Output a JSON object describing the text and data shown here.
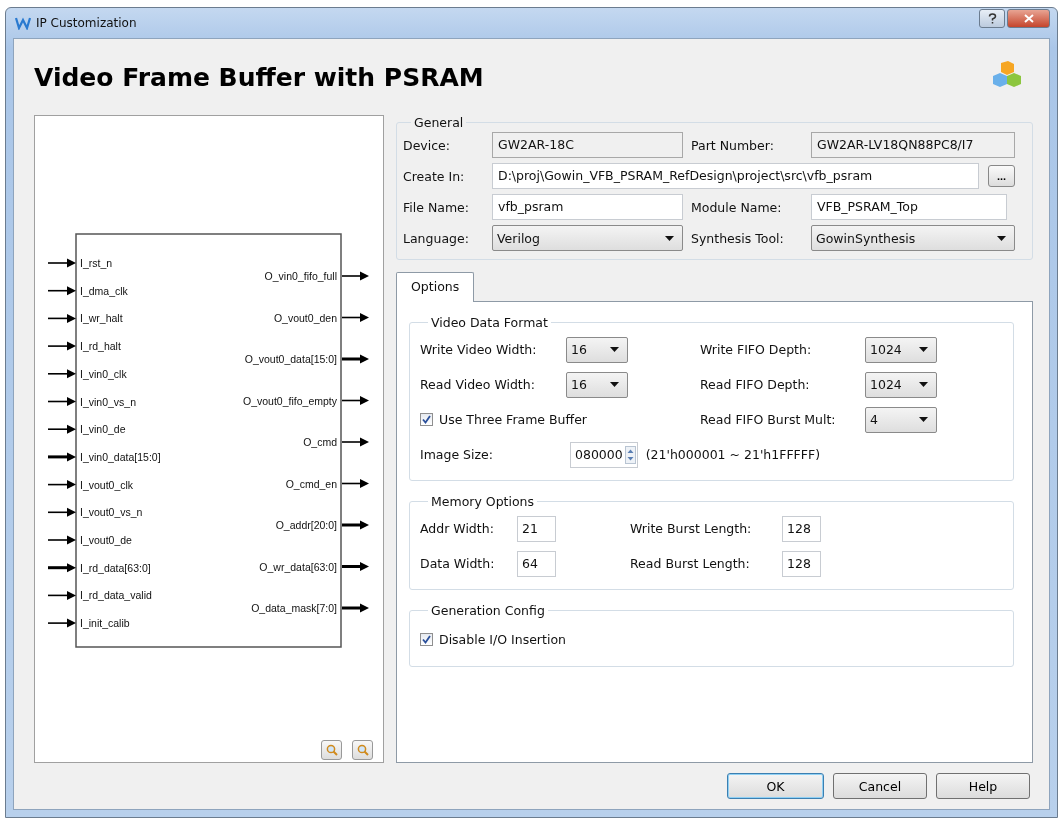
{
  "window": {
    "title": "IP Customization"
  },
  "header": {
    "title": "Video Frame Buffer with PSRAM"
  },
  "schematic": {
    "inputs": [
      {
        "name": "I_rst_n",
        "bus": false
      },
      {
        "name": "I_dma_clk",
        "bus": false
      },
      {
        "name": "I_wr_halt",
        "bus": false
      },
      {
        "name": "I_rd_halt",
        "bus": false
      },
      {
        "name": "I_vin0_clk",
        "bus": false
      },
      {
        "name": "I_vin0_vs_n",
        "bus": false
      },
      {
        "name": "I_vin0_de",
        "bus": false
      },
      {
        "name": "I_vin0_data[15:0]",
        "bus": true
      },
      {
        "name": "I_vout0_clk",
        "bus": false
      },
      {
        "name": "I_vout0_vs_n",
        "bus": false
      },
      {
        "name": "I_vout0_de",
        "bus": false
      },
      {
        "name": "I_rd_data[63:0]",
        "bus": true
      },
      {
        "name": "I_rd_data_valid",
        "bus": false
      },
      {
        "name": "I_init_calib",
        "bus": false
      }
    ],
    "outputs": [
      {
        "name": "O_vin0_fifo_full",
        "bus": false
      },
      {
        "name": "O_vout0_den",
        "bus": false
      },
      {
        "name": "O_vout0_data[15:0]",
        "bus": true
      },
      {
        "name": "O_vout0_fifo_empty",
        "bus": false
      },
      {
        "name": "O_cmd",
        "bus": false
      },
      {
        "name": "O_cmd_en",
        "bus": false
      },
      {
        "name": "O_addr[20:0]",
        "bus": true
      },
      {
        "name": "O_wr_data[63:0]",
        "bus": true
      },
      {
        "name": "O_data_mask[7:0]",
        "bus": true
      }
    ]
  },
  "general": {
    "title": "General",
    "fields": [
      {
        "kind": "readonly",
        "label": "Device:",
        "value": "GW2AR-18C"
      },
      {
        "kind": "readonly",
        "label": "Part Number:",
        "value": "GW2AR-LV18QN88PC8/I7"
      },
      {
        "kind": "path",
        "label": "Create In:",
        "value": "D:\\proj\\Gowin_VFB_PSRAM_RefDesign\\project\\src\\vfb_psram",
        "button": "..."
      },
      {
        "kind": "text",
        "label": "File Name:",
        "value": "vfb_psram"
      },
      {
        "kind": "text",
        "label": "Module Name:",
        "value": "VFB_PSRAM_Top"
      },
      {
        "kind": "dropdown",
        "label": "Language:",
        "value": "Verilog"
      },
      {
        "kind": "dropdown",
        "label": "Synthesis Tool:",
        "value": "GowinSynthesis"
      }
    ]
  },
  "tabs": [
    {
      "label": "Options",
      "selected": true
    }
  ],
  "groups": [
    {
      "title": "Video Data Format",
      "rows": [
        [
          {
            "kind": "dropdown",
            "label": "Write Video Width:",
            "value": "16"
          },
          {
            "kind": "dropdown",
            "label": "Write FIFO Depth:",
            "value": "1024"
          }
        ],
        [
          {
            "kind": "dropdown",
            "label": "Read Video Width:",
            "value": "16"
          },
          {
            "kind": "dropdown",
            "label": "Read FIFO Depth:",
            "value": "1024"
          }
        ],
        [
          {
            "kind": "checkbox",
            "label": "Use Three Frame Buffer",
            "checked": true
          },
          {
            "kind": "dropdown",
            "label": "Read FIFO Burst Mult:",
            "value": "4"
          }
        ],
        [
          {
            "kind": "spin",
            "label": "Image Size:",
            "value": "080000",
            "hint": "(21'h000001 ~ 21'h1FFFFF)"
          }
        ]
      ]
    },
    {
      "title": "Memory Options",
      "rows": [
        [
          {
            "kind": "text",
            "label": "Addr Width:",
            "value": "21"
          },
          {
            "kind": "text",
            "label": "Write Burst Length:",
            "value": "128"
          }
        ],
        [
          {
            "kind": "text",
            "label": "Data Width:",
            "value": "64"
          },
          {
            "kind": "text",
            "label": "Read Burst Length:",
            "value": "128"
          }
        ]
      ]
    },
    {
      "title": "Generation Config",
      "rows": [
        [
          {
            "kind": "checkbox",
            "label": "Disable I/O Insertion",
            "checked": true
          }
        ]
      ]
    }
  ],
  "buttons": [
    {
      "label": "OK",
      "default": true
    },
    {
      "label": "Cancel",
      "default": false
    },
    {
      "label": "Help",
      "default": false
    }
  ]
}
